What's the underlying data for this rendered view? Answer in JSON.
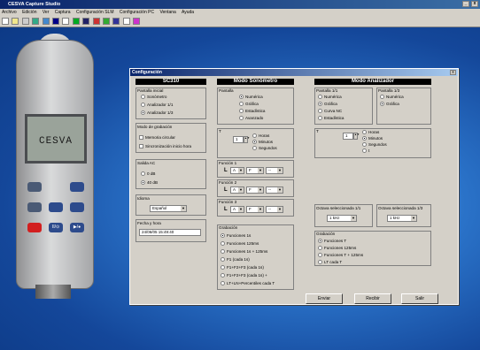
{
  "window": {
    "title": "CESVA Capture Studio"
  },
  "menu": [
    "Archivo",
    "Edición",
    "Ver",
    "Captura",
    "Configuración SLM",
    "Configuración PC",
    "Ventana",
    "Ayuda"
  ],
  "meter": {
    "brand": "CESVA",
    "keys": [
      "",
      "",
      "",
      "",
      "",
      "",
      "II/⊙",
      "▶/●"
    ]
  },
  "dialog": {
    "title": "Configuración",
    "sc310": {
      "header": "SC310",
      "pantalla_inicial": {
        "label": "Pantalla inicial",
        "options": [
          "Sonómetro",
          "Analizador 1/1",
          "Analizador 1/3"
        ],
        "selected": 2
      },
      "modo_grabacion": {
        "label": "Modo de grabación",
        "options": [
          "Memoria circular",
          "Sincronización inicio hora"
        ]
      },
      "salida_ac": {
        "label": "Salida AC",
        "options": [
          "0 dB",
          "40 dB"
        ],
        "selected": 1
      },
      "idioma": {
        "label": "Idioma",
        "value": "Español"
      },
      "fecha": {
        "label": "Fecha y hora",
        "value": "24/06/05 15:49:40"
      }
    },
    "sonometro": {
      "header": "Modo Sonómetro",
      "pantalla": {
        "label": "Pantalla",
        "options": [
          "Numérica",
          "Gráfica",
          "Estadística",
          "Avanzado"
        ],
        "selected": 0
      },
      "t": {
        "label": "T",
        "value": "1",
        "options": [
          "Horas",
          "Minutos",
          "Segundos"
        ],
        "selected": 1
      },
      "funciones": [
        {
          "label": "Función 1",
          "prefix": "L",
          "values": [
            "A",
            "F",
            "--"
          ]
        },
        {
          "label": "Función 2",
          "prefix": "L",
          "values": [
            "A",
            "F",
            "--"
          ]
        },
        {
          "label": "Función 3",
          "prefix": "L",
          "values": [
            "A",
            "F",
            "--"
          ]
        }
      ],
      "grabacion": {
        "label": "Grabación",
        "options": [
          "Funciones 1s",
          "Funciones 125ms",
          "Funciones 1s + 125ms",
          "F1 (cada 1s)",
          "F1+F2+F3 (cada 1s)",
          "F1+F2+F3 (cada 1s) +",
          "LT+LN+Percentiles cada T"
        ],
        "selected": 0
      }
    },
    "analizador": {
      "header": "Modo Analizador",
      "pantalla11": {
        "label": "Pantalla 1/1",
        "options": [
          "Numérica",
          "Gráfica",
          "Curva NC",
          "Estadística"
        ],
        "selected": 1
      },
      "pantalla13": {
        "label": "Pantalla 1/3",
        "options": [
          "Numérica",
          "Gráfica"
        ],
        "selected": 1
      },
      "t": {
        "label": "T",
        "value": "1",
        "options": [
          "Horas",
          "Minutos",
          "Segundos",
          "t"
        ],
        "selected": 1
      },
      "octava11": {
        "label": "Octava seleccionada 1/1",
        "value": "1 kHz"
      },
      "octava13": {
        "label": "Octava seleccionada 1/3",
        "value": "1 kHz"
      },
      "grabacion": {
        "label": "Grabación",
        "options": [
          "Funciones T",
          "Funciones 125ms",
          "Funciones T + 125ms",
          "LT cada T"
        ],
        "selected": 0
      }
    },
    "buttons": {
      "enviar": "Enviar",
      "recibir": "Recibir",
      "salir": "Salir"
    }
  }
}
